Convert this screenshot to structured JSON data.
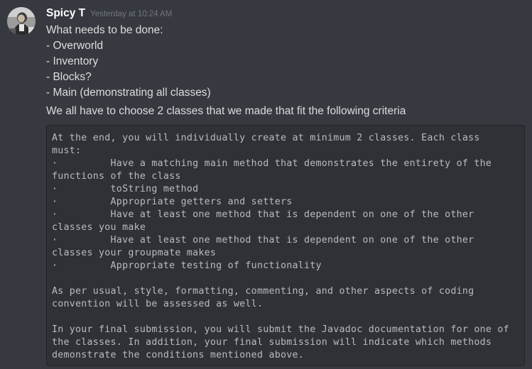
{
  "message": {
    "author": "Spicy T",
    "timestamp": "Yesterday at 10:24 AM",
    "lines": [
      "What needs to be done:",
      "- Overworld",
      "- Inventory",
      "- Blocks?",
      "- Main (demonstrating all classes)",
      "We all have to choose 2 classes that we made that fit the following criteria"
    ],
    "code_lines": [
      "At the end, you will individually create at minimum 2 classes. Each class",
      "must:",
      "·         Have a matching main method that demonstrates the entirety of the",
      "functions of the class",
      "·         toString method",
      "·         Appropriate getters and setters",
      "·         Have at least one method that is dependent on one of the other",
      "classes you make",
      "·         Have at least one method that is dependent on one of the other",
      "classes your groupmate makes",
      "·         Appropriate testing of functionality",
      "",
      "As per usual, style, formatting, commenting, and other aspects of coding",
      "convention will be assessed as well.",
      "",
      "In your final submission, you will submit the Javadoc documentation for one of",
      "the classes. In addition, your final submission will indicate which methods",
      "demonstrate the conditions mentioned above."
    ]
  }
}
